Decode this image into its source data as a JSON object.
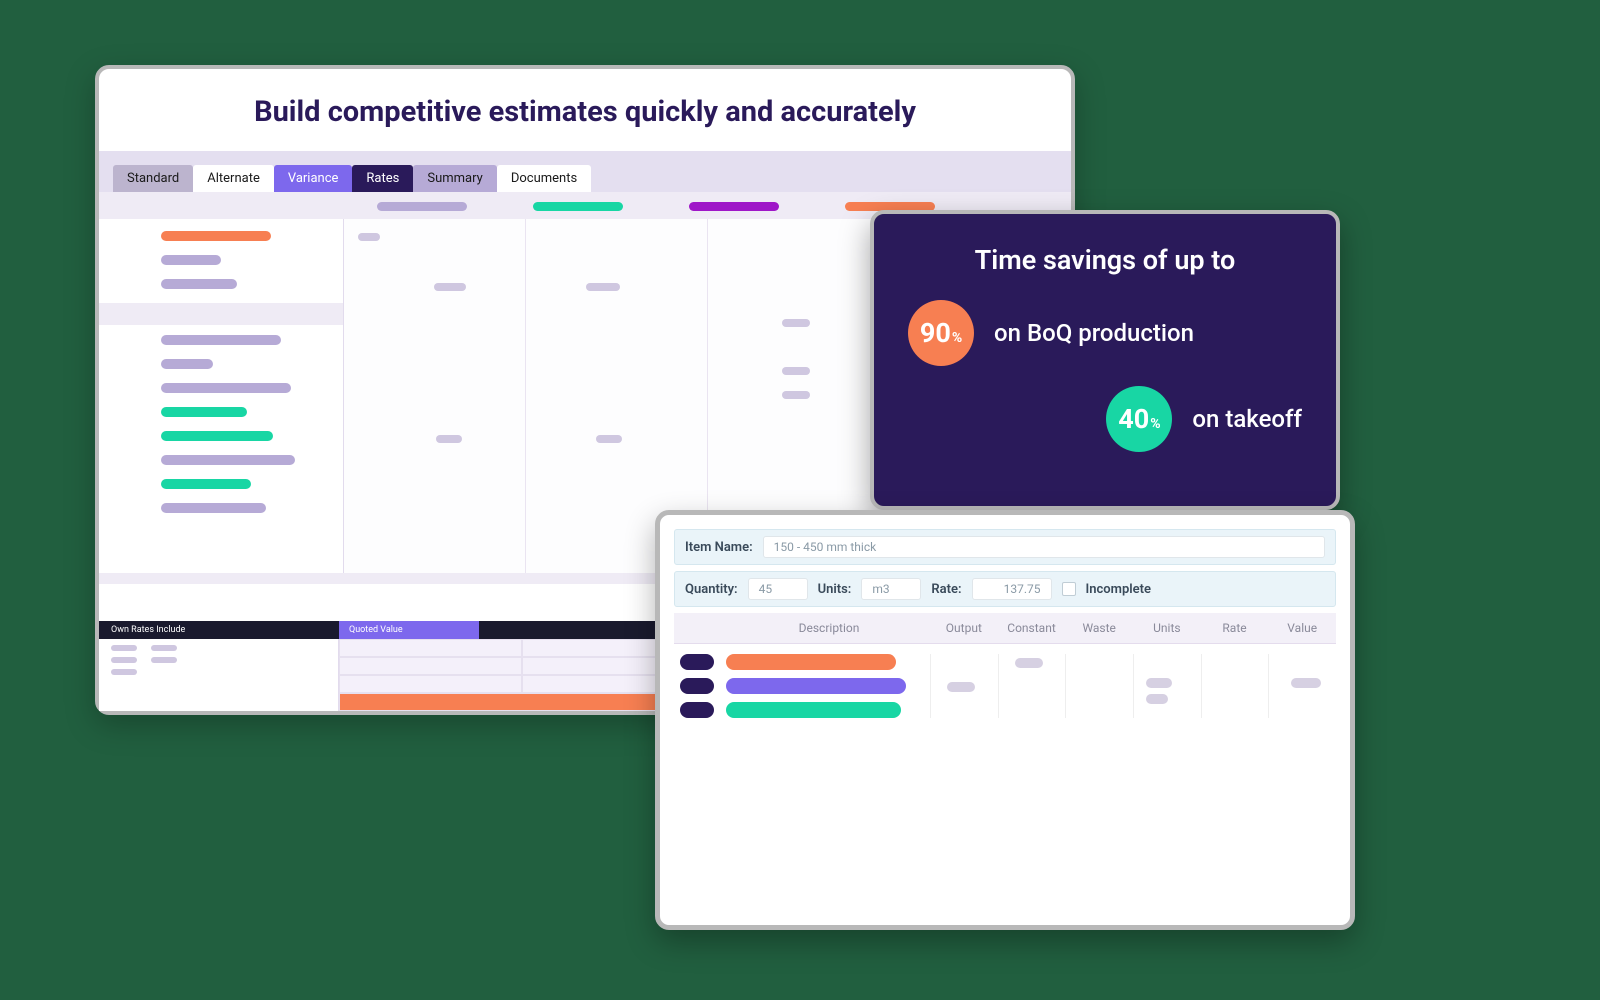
{
  "main": {
    "title": "Build competitive estimates quickly and accurately",
    "tabs": [
      {
        "label": "Standard",
        "style": "gray"
      },
      {
        "label": "Alternate",
        "style": "white"
      },
      {
        "label": "Variance",
        "style": "purple"
      },
      {
        "label": "Rates",
        "style": "dark"
      },
      {
        "label": "Summary",
        "style": "lav"
      },
      {
        "label": "Documents",
        "style": "white"
      }
    ],
    "footer": {
      "seg1": "Own Rates Include",
      "seg2": "Quoted Value"
    }
  },
  "callout": {
    "title": "Time savings of up to",
    "rows": [
      {
        "value": "90",
        "pct": "%",
        "text": "on BoQ production",
        "color": "orange"
      },
      {
        "value": "40",
        "pct": "%",
        "text": "on takeoff",
        "color": "teal"
      }
    ]
  },
  "detail": {
    "item_name_label": "Item Name:",
    "item_name_value": "150 - 450 mm thick",
    "quantity_label": "Quantity:",
    "quantity_value": "45",
    "units_label": "Units:",
    "units_value": "m3",
    "rate_label": "Rate:",
    "rate_value": "137.75",
    "incomplete_label": "Incomplete",
    "headers": {
      "description": "Description",
      "output": "Output",
      "constant": "Constant",
      "waste": "Waste",
      "units": "Units",
      "rate": "Rate",
      "value": "Value"
    }
  }
}
